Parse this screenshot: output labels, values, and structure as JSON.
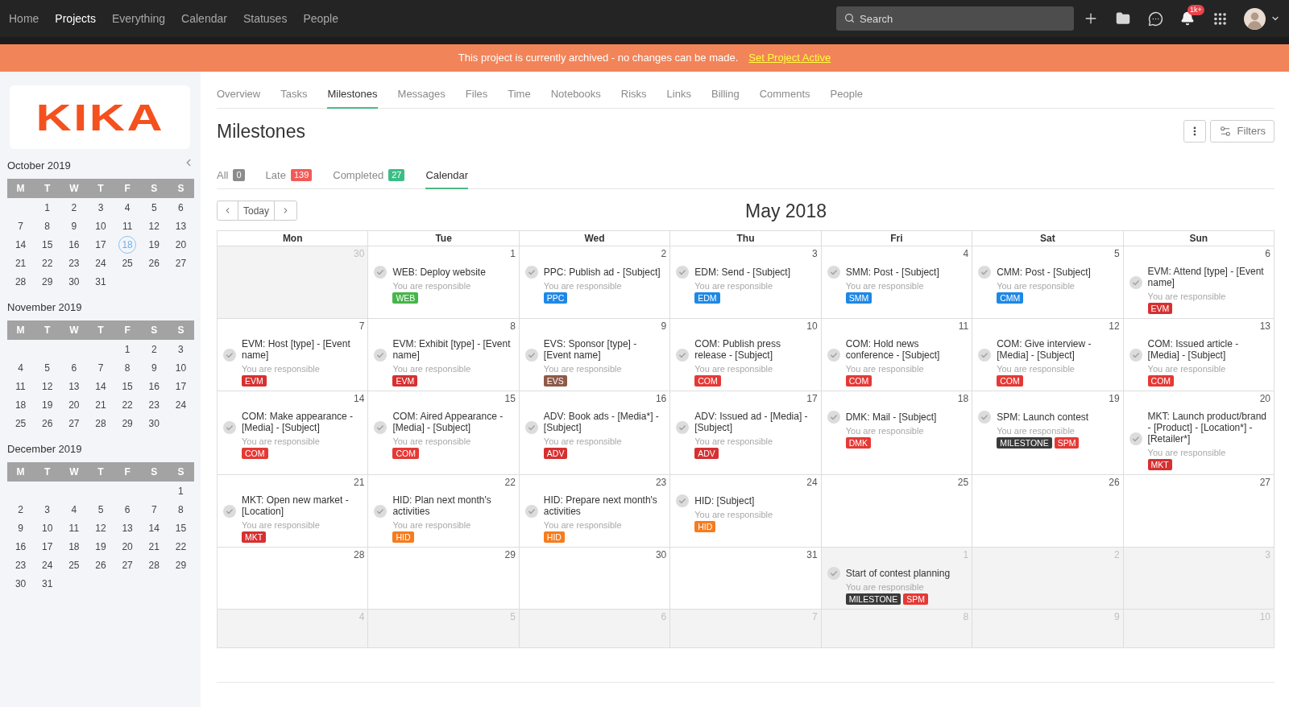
{
  "top_bar": {
    "nav": [
      {
        "label": "Home",
        "selected": false
      },
      {
        "label": "Projects",
        "selected": true
      },
      {
        "label": "Everything",
        "selected": false
      },
      {
        "label": "Calendar",
        "selected": false
      },
      {
        "label": "Statuses",
        "selected": false
      },
      {
        "label": "People",
        "selected": false
      }
    ],
    "search": {
      "placeholder": "Search"
    },
    "notification_count": "1k+"
  },
  "banner": {
    "message": "This project is currently archived - no changes can be made.",
    "link": "Set Project Active"
  },
  "sidebar": {
    "logo": "KIKA",
    "months": [
      {
        "title": "October 2019",
        "weekdays": [
          "M",
          "T",
          "W",
          "T",
          "F",
          "S",
          "S"
        ],
        "weeks": [
          {
            "kind": "leading",
            "days": [
              {
                "day": "1",
                "selected": false
              },
              {
                "day": "2",
                "selected": false
              },
              {
                "day": "3",
                "selected": false
              },
              {
                "day": "4",
                "selected": false
              },
              {
                "day": "5",
                "selected": false
              },
              {
                "day": "6",
                "selected": false
              }
            ]
          },
          {
            "kind": "full",
            "days": [
              {
                "day": "7",
                "selected": false
              },
              {
                "day": "8",
                "selected": false
              },
              {
                "day": "9",
                "selected": false
              },
              {
                "day": "10",
                "selected": false
              },
              {
                "day": "11",
                "selected": false
              },
              {
                "day": "12",
                "selected": false
              },
              {
                "day": "13",
                "selected": false
              }
            ]
          },
          {
            "kind": "full",
            "days": [
              {
                "day": "14",
                "selected": false
              },
              {
                "day": "15",
                "selected": false
              },
              {
                "day": "16",
                "selected": false
              },
              {
                "day": "17",
                "selected": false
              },
              {
                "day": "18",
                "selected": true
              },
              {
                "day": "19",
                "selected": false
              },
              {
                "day": "20",
                "selected": false
              }
            ]
          },
          {
            "kind": "full",
            "days": [
              {
                "day": "21",
                "selected": false
              },
              {
                "day": "22",
                "selected": false
              },
              {
                "day": "23",
                "selected": false
              },
              {
                "day": "24",
                "selected": false
              },
              {
                "day": "25",
                "selected": false
              },
              {
                "day": "26",
                "selected": false
              },
              {
                "day": "27",
                "selected": false
              }
            ]
          },
          {
            "kind": "trailing",
            "days": [
              {
                "day": "28",
                "selected": false
              },
              {
                "day": "29",
                "selected": false
              },
              {
                "day": "30",
                "selected": false
              },
              {
                "day": "31",
                "selected": false
              }
            ]
          }
        ]
      },
      {
        "title": "November 2019",
        "weekdays": [
          "M",
          "T",
          "W",
          "T",
          "F",
          "S",
          "S"
        ],
        "weeks": [
          {
            "kind": "leading",
            "days": [
              {
                "day": "1",
                "selected": false
              },
              {
                "day": "2",
                "selected": false
              },
              {
                "day": "3",
                "selected": false
              }
            ]
          },
          {
            "kind": "full",
            "days": [
              {
                "day": "4",
                "selected": false
              },
              {
                "day": "5",
                "selected": false
              },
              {
                "day": "6",
                "selected": false
              },
              {
                "day": "7",
                "selected": false
              },
              {
                "day": "8",
                "selected": false
              },
              {
                "day": "9",
                "selected": false
              },
              {
                "day": "10",
                "selected": false
              }
            ]
          },
          {
            "kind": "full",
            "days": [
              {
                "day": "11",
                "selected": false
              },
              {
                "day": "12",
                "selected": false
              },
              {
                "day": "13",
                "selected": false
              },
              {
                "day": "14",
                "selected": false
              },
              {
                "day": "15",
                "selected": false
              },
              {
                "day": "16",
                "selected": false
              },
              {
                "day": "17",
                "selected": false
              }
            ]
          },
          {
            "kind": "full",
            "days": [
              {
                "day": "18",
                "selected": false
              },
              {
                "day": "19",
                "selected": false
              },
              {
                "day": "20",
                "selected": false
              },
              {
                "day": "21",
                "selected": false
              },
              {
                "day": "22",
                "selected": false
              },
              {
                "day": "23",
                "selected": false
              },
              {
                "day": "24",
                "selected": false
              }
            ]
          },
          {
            "kind": "trailing",
            "days": [
              {
                "day": "25",
                "selected": false
              },
              {
                "day": "26",
                "selected": false
              },
              {
                "day": "27",
                "selected": false
              },
              {
                "day": "28",
                "selected": false
              },
              {
                "day": "29",
                "selected": false
              },
              {
                "day": "30",
                "selected": false
              }
            ]
          }
        ]
      },
      {
        "title": "December 2019",
        "weekdays": [
          "M",
          "T",
          "W",
          "T",
          "F",
          "S",
          "S"
        ],
        "weeks": [
          {
            "kind": "leading",
            "days": [
              {
                "day": "1",
                "selected": false
              }
            ]
          },
          {
            "kind": "full",
            "days": [
              {
                "day": "2",
                "selected": false
              },
              {
                "day": "3",
                "selected": false
              },
              {
                "day": "4",
                "selected": false
              },
              {
                "day": "5",
                "selected": false
              },
              {
                "day": "6",
                "selected": false
              },
              {
                "day": "7",
                "selected": false
              },
              {
                "day": "8",
                "selected": false
              }
            ]
          },
          {
            "kind": "full",
            "days": [
              {
                "day": "9",
                "selected": false
              },
              {
                "day": "10",
                "selected": false
              },
              {
                "day": "11",
                "selected": false
              },
              {
                "day": "12",
                "selected": false
              },
              {
                "day": "13",
                "selected": false
              },
              {
                "day": "14",
                "selected": false
              },
              {
                "day": "15",
                "selected": false
              }
            ]
          },
          {
            "kind": "full",
            "days": [
              {
                "day": "16",
                "selected": false
              },
              {
                "day": "17",
                "selected": false
              },
              {
                "day": "18",
                "selected": false
              },
              {
                "day": "19",
                "selected": false
              },
              {
                "day": "20",
                "selected": false
              },
              {
                "day": "21",
                "selected": false
              },
              {
                "day": "22",
                "selected": false
              }
            ]
          },
          {
            "kind": "full",
            "days": [
              {
                "day": "23",
                "selected": false
              },
              {
                "day": "24",
                "selected": false
              },
              {
                "day": "25",
                "selected": false
              },
              {
                "day": "26",
                "selected": false
              },
              {
                "day": "27",
                "selected": false
              },
              {
                "day": "28",
                "selected": false
              },
              {
                "day": "29",
                "selected": false
              }
            ]
          },
          {
            "kind": "trailing",
            "days": [
              {
                "day": "30",
                "selected": false
              },
              {
                "day": "31",
                "selected": false
              }
            ]
          }
        ]
      }
    ]
  },
  "main": {
    "tabs": [
      {
        "label": "Overview",
        "selected": false
      },
      {
        "label": "Tasks",
        "selected": false
      },
      {
        "label": "Milestones",
        "selected": true
      },
      {
        "label": "Messages",
        "selected": false
      },
      {
        "label": "Files",
        "selected": false
      },
      {
        "label": "Time",
        "selected": false
      },
      {
        "label": "Notebooks",
        "selected": false
      },
      {
        "label": "Risks",
        "selected": false
      },
      {
        "label": "Links",
        "selected": false
      },
      {
        "label": "Billing",
        "selected": false
      },
      {
        "label": "Comments",
        "selected": false
      },
      {
        "label": "People",
        "selected": false
      }
    ],
    "title": "Milestones",
    "filters_button": "Filters",
    "view_tabs": [
      {
        "label": "All",
        "count": "0",
        "color": "#8c8c8c",
        "selected": false
      },
      {
        "label": "Late",
        "count": "139",
        "color": "#f25a57",
        "selected": false
      },
      {
        "label": "Completed",
        "count": "27",
        "color": "#3dbd86",
        "selected": false
      },
      {
        "label": "Calendar",
        "selected": true
      }
    ],
    "calendar": {
      "today_button": "Today",
      "title": "May 2018",
      "weekdays": [
        "Mon",
        "Tue",
        "Wed",
        "Thu",
        "Fri",
        "Sat",
        "Sun"
      ],
      "weeks": [
        [
          {
            "date": "30",
            "outside_month": true
          },
          {
            "date": "1",
            "outside_month": false,
            "events": [
              {
                "title": "WEB: Deploy website",
                "note": "You are responsible",
                "tags": [
                  {
                    "label": "WEB",
                    "color": "#45b649"
                  }
                ]
              }
            ]
          },
          {
            "date": "2",
            "outside_month": false,
            "events": [
              {
                "title": "PPC: Publish ad - [Subject]",
                "note": "You are responsible",
                "tags": [
                  {
                    "label": "PPC",
                    "color": "#1e88e5"
                  }
                ]
              }
            ]
          },
          {
            "date": "3",
            "outside_month": false,
            "events": [
              {
                "title": "EDM: Send - [Subject]",
                "note": "You are responsible",
                "tags": [
                  {
                    "label": "EDM",
                    "color": "#1e88e5"
                  }
                ]
              }
            ]
          },
          {
            "date": "4",
            "outside_month": false,
            "events": [
              {
                "title": "SMM: Post - [Subject]",
                "note": "You are responsible",
                "tags": [
                  {
                    "label": "SMM",
                    "color": "#1e88e5"
                  }
                ]
              }
            ]
          },
          {
            "date": "5",
            "outside_month": false,
            "events": [
              {
                "title": "CMM: Post - [Subject]",
                "note": "You are responsible",
                "tags": [
                  {
                    "label": "CMM",
                    "color": "#1e88e5"
                  }
                ]
              }
            ]
          },
          {
            "date": "6",
            "outside_month": false,
            "events": [
              {
                "title": "EVM: Attend [type] - [Event name]",
                "note": "You are responsible",
                "tags": [
                  {
                    "label": "EVM",
                    "color": "#d63031"
                  }
                ]
              }
            ]
          }
        ],
        [
          {
            "date": "7",
            "outside_month": false,
            "events": [
              {
                "title": "EVM: Host [type] - [Event name]",
                "note": "You are responsible",
                "tags": [
                  {
                    "label": "EVM",
                    "color": "#d63031"
                  }
                ]
              }
            ]
          },
          {
            "date": "8",
            "outside_month": false,
            "events": [
              {
                "title": "EVM: Exhibit [type] - [Event name]",
                "note": "You are responsible",
                "tags": [
                  {
                    "label": "EVM",
                    "color": "#d63031"
                  }
                ]
              }
            ]
          },
          {
            "date": "9",
            "outside_month": false,
            "events": [
              {
                "title": "EVS: Sponsor [type] - [Event name]",
                "note": "You are responsible",
                "tags": [
                  {
                    "label": "EVS",
                    "color": "#8e5a48"
                  }
                ]
              }
            ]
          },
          {
            "date": "10",
            "outside_month": false,
            "events": [
              {
                "title": "COM: Publish press release - [Subject]",
                "note": "You are responsible",
                "tags": [
                  {
                    "label": "COM",
                    "color": "#e53935"
                  }
                ]
              }
            ]
          },
          {
            "date": "11",
            "outside_month": false,
            "events": [
              {
                "title": "COM: Hold news conference - [Subject]",
                "note": "You are responsible",
                "tags": [
                  {
                    "label": "COM",
                    "color": "#e53935"
                  }
                ]
              }
            ]
          },
          {
            "date": "12",
            "outside_month": false,
            "events": [
              {
                "title": "COM: Give interview - [Media] - [Subject]",
                "note": "You are responsible",
                "tags": [
                  {
                    "label": "COM",
                    "color": "#e53935"
                  }
                ]
              }
            ]
          },
          {
            "date": "13",
            "outside_month": false,
            "events": [
              {
                "title": "COM: Issued article - [Media] - [Subject]",
                "note": "You are responsible",
                "tags": [
                  {
                    "label": "COM",
                    "color": "#e53935"
                  }
                ]
              }
            ]
          }
        ],
        [
          {
            "date": "14",
            "outside_month": false,
            "events": [
              {
                "title": "COM: Make appearance - [Media] - [Subject]",
                "note": "You are responsible",
                "tags": [
                  {
                    "label": "COM",
                    "color": "#e53935"
                  }
                ]
              }
            ]
          },
          {
            "date": "15",
            "outside_month": false,
            "events": [
              {
                "title": "COM: Aired Appearance - [Media] - [Subject]",
                "note": "You are responsible",
                "tags": [
                  {
                    "label": "COM",
                    "color": "#e53935"
                  }
                ]
              }
            ]
          },
          {
            "date": "16",
            "outside_month": false,
            "events": [
              {
                "title": "ADV: Book ads - [Media*] - [Subject]",
                "note": "You are responsible",
                "tags": [
                  {
                    "label": "ADV",
                    "color": "#d63031"
                  }
                ]
              }
            ]
          },
          {
            "date": "17",
            "outside_month": false,
            "events": [
              {
                "title": "ADV: Issued ad - [Media] - [Subject]",
                "note": "You are responsible",
                "tags": [
                  {
                    "label": "ADV",
                    "color": "#d63031"
                  }
                ]
              }
            ]
          },
          {
            "date": "18",
            "outside_month": false,
            "events": [
              {
                "title": "DMK: Mail - [Subject]",
                "note": "You are responsible",
                "tags": [
                  {
                    "label": "DMK",
                    "color": "#e53935"
                  }
                ]
              }
            ]
          },
          {
            "date": "19",
            "outside_month": false,
            "events": [
              {
                "title": "SPM: Launch contest",
                "note": "You are responsible",
                "tags": [
                  {
                    "label": "MILESTONE",
                    "color": "#3a3a3a"
                  },
                  {
                    "label": "SPM",
                    "color": "#e53935"
                  }
                ]
              }
            ]
          },
          {
            "date": "20",
            "outside_month": false,
            "events": [
              {
                "title": "MKT: Launch product/brand - [Product] - [Location*] - [Retailer*]",
                "note": "You are responsible",
                "tags": [
                  {
                    "label": "MKT",
                    "color": "#d63031"
                  }
                ]
              }
            ]
          }
        ],
        [
          {
            "date": "21",
            "outside_month": false,
            "events": [
              {
                "title": "MKT: Open new market - [Location]",
                "note": "You are responsible",
                "tags": [
                  {
                    "label": "MKT",
                    "color": "#d63031"
                  }
                ]
              }
            ]
          },
          {
            "date": "22",
            "outside_month": false,
            "events": [
              {
                "title": "HID: Plan next month's activities",
                "note": "You are responsible",
                "tags": [
                  {
                    "label": "HID",
                    "color": "#f57c1f"
                  }
                ]
              }
            ]
          },
          {
            "date": "23",
            "outside_month": false,
            "events": [
              {
                "title": "HID: Prepare next month's activities",
                "note": "You are responsible",
                "tags": [
                  {
                    "label": "HID",
                    "color": "#f57c1f"
                  }
                ]
              }
            ]
          },
          {
            "date": "24",
            "outside_month": false,
            "events": [
              {
                "title": "HID: [Subject]",
                "note": "You are responsible",
                "tags": [
                  {
                    "label": "HID",
                    "color": "#f57c1f"
                  }
                ]
              }
            ]
          },
          {
            "date": "25",
            "outside_month": false
          },
          {
            "date": "26",
            "outside_month": false
          },
          {
            "date": "27",
            "outside_month": false
          }
        ],
        [
          {
            "date": "28",
            "outside_month": false
          },
          {
            "date": "29",
            "outside_month": false
          },
          {
            "date": "30",
            "outside_month": false
          },
          {
            "date": "31",
            "outside_month": false
          },
          {
            "date": "1",
            "outside_month": true,
            "events": [
              {
                "title": "Start of contest planning",
                "note": "You are responsible",
                "tags": [
                  {
                    "label": "MILESTONE",
                    "color": "#3a3a3a"
                  },
                  {
                    "label": "SPM",
                    "color": "#e53935"
                  }
                ]
              }
            ]
          },
          {
            "date": "2",
            "outside_month": true
          },
          {
            "date": "3",
            "outside_month": true
          }
        ],
        [
          {
            "date": "4",
            "outside_month": true
          },
          {
            "date": "5",
            "outside_month": true
          },
          {
            "date": "6",
            "outside_month": true
          },
          {
            "date": "7",
            "outside_month": true
          },
          {
            "date": "8",
            "outside_month": true
          },
          {
            "date": "9",
            "outside_month": true
          },
          {
            "date": "10",
            "outside_month": true
          }
        ]
      ]
    }
  }
}
